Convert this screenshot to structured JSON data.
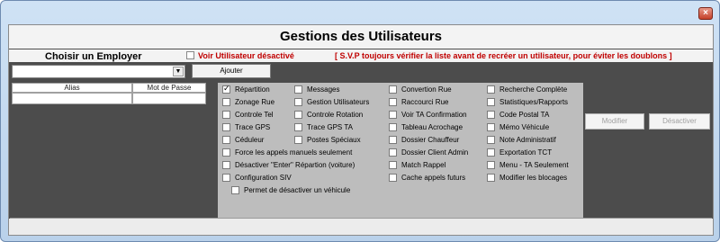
{
  "window": {
    "title": "Gestions des Utilisateurs",
    "close_glyph": "×"
  },
  "header": {
    "choose_label": "Choisir un Employer",
    "show_disabled_label": "Voir Utilisateur désactivé",
    "warning": "[ S.V.P toujours vérifier la liste avant de recréer un utilisateur, pour éviter les doublons ]"
  },
  "toolbar": {
    "employee_combo_value": "",
    "add_button": "Ajouter"
  },
  "grid": {
    "columns": [
      "Alias",
      "Mot de Passe"
    ]
  },
  "actions": {
    "modify_button": "Modifier",
    "deactivate_button": "Désactiver"
  },
  "permissions": {
    "col1": [
      {
        "label": "Répartition",
        "checked": true
      },
      {
        "label": "Zonage Rue",
        "checked": false
      },
      {
        "label": "Controle Tel",
        "checked": false
      },
      {
        "label": "Trace GPS",
        "checked": false
      },
      {
        "label": "Céduleur",
        "checked": false
      }
    ],
    "col2": [
      {
        "label": "Messages",
        "checked": false
      },
      {
        "label": "Gestion Utilisateurs",
        "checked": false
      },
      {
        "label": "Controle Rotation",
        "checked": false
      },
      {
        "label": "Trace GPS TA",
        "checked": false
      },
      {
        "label": "Postes Spéciaux",
        "checked": false
      }
    ],
    "col3": [
      {
        "label": "Convertion Rue",
        "checked": false
      },
      {
        "label": "Raccourci Rue",
        "checked": false
      },
      {
        "label": "Voir TA Confirmation",
        "checked": false
      },
      {
        "label": "Tableau Acrochage",
        "checked": false
      },
      {
        "label": "Dossier Chauffeur",
        "checked": false
      },
      {
        "label": "Dossier Client Admin",
        "checked": false
      },
      {
        "label": "Match Rappel",
        "checked": false
      },
      {
        "label": "Cache appels futurs",
        "checked": false
      }
    ],
    "col4": [
      {
        "label": "Recherche Complète",
        "checked": false
      },
      {
        "label": "Statistiques/Rapports",
        "checked": false
      },
      {
        "label": "Code Postal TA",
        "checked": false
      },
      {
        "label": "Mémo Véhicule",
        "checked": false
      },
      {
        "label": "Note Administratif",
        "checked": false
      },
      {
        "label": "Exportation TCT",
        "checked": false
      },
      {
        "label": "Menu - TA Seulement",
        "checked": false
      },
      {
        "label": "Modifier les blocages",
        "checked": false
      }
    ],
    "wide": [
      {
        "label": "Force les appels manuels seulement",
        "checked": false
      },
      {
        "label": "Désactiver \"Enter\" Répartion (voiture)",
        "checked": false
      },
      {
        "label": "Configuration SIV",
        "checked": false
      },
      {
        "label": "Permet de désactiver un véhicule",
        "checked": false
      }
    ]
  },
  "colors": {
    "dark_panel": "#4c4c4c",
    "permission_bg": "#bdbdbd",
    "warning_text": "#c00000"
  }
}
